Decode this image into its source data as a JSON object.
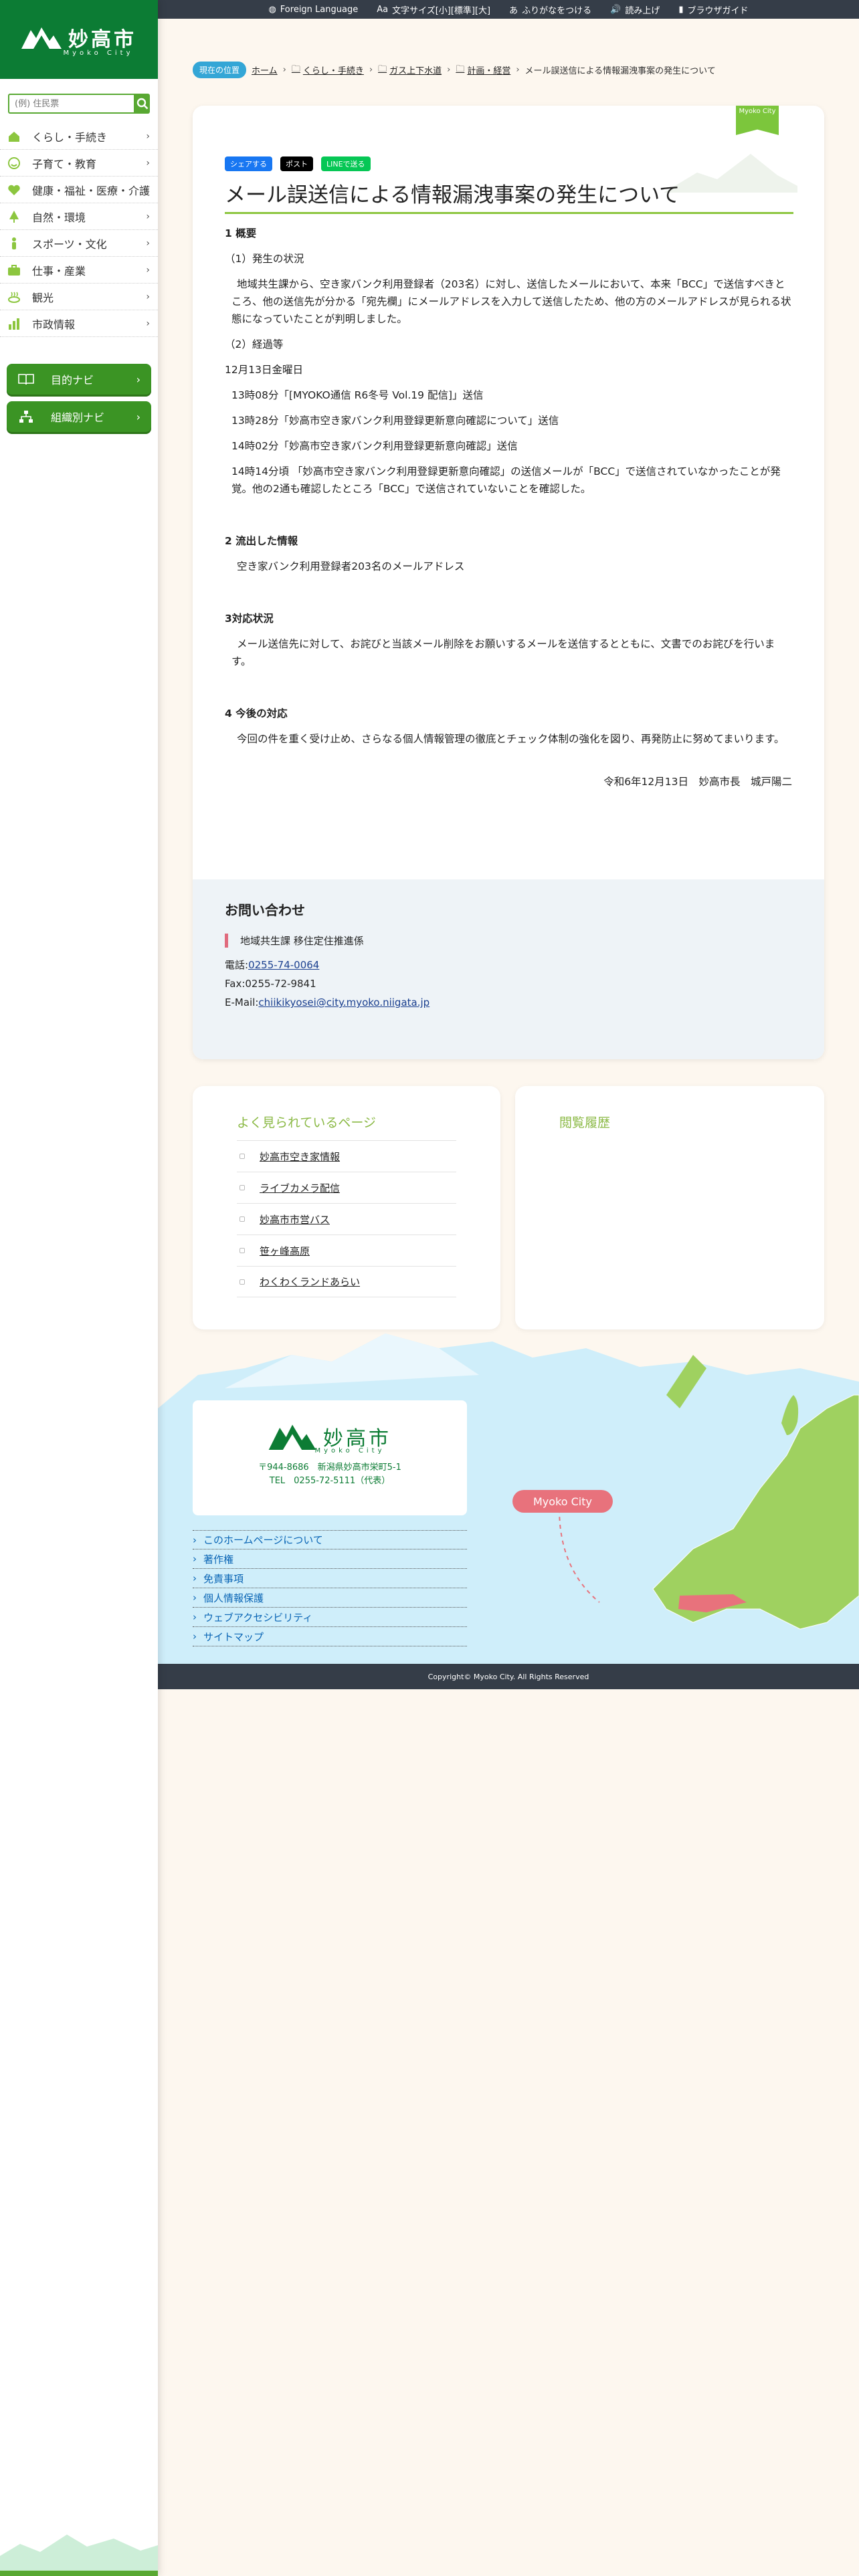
{
  "site": {
    "name": "妙高市",
    "sub": "Myoko City"
  },
  "topbar": {
    "foreign": "Foreign Language",
    "fontsize": "文字サイズ[小][標準][大]",
    "furigana": "ふりがなをつける",
    "readaloud": "読み上げ",
    "browser_guide": "ブラウザガイド"
  },
  "search": {
    "placeholder": "(例) 住民票"
  },
  "menu": [
    {
      "label": "くらし・手続き",
      "icon": "house-icon"
    },
    {
      "label": "子育て・教育",
      "icon": "smile-icon"
    },
    {
      "label": "健康・福祉・医療・介護",
      "icon": "heart-icon"
    },
    {
      "label": "自然・環境",
      "icon": "tree-icon"
    },
    {
      "label": "スポーツ・文化",
      "icon": "person-icon"
    },
    {
      "label": "仕事・産業",
      "icon": "briefcase-icon"
    },
    {
      "label": "観光",
      "icon": "onsen-icon"
    },
    {
      "label": "市政情報",
      "icon": "bar-chart-icon"
    }
  ],
  "navbuttons": {
    "purpose": "目的ナビ",
    "org": "組織別ナビ"
  },
  "breadcrumb": {
    "here": "現在の位置",
    "home": "ホーム",
    "c1": "くらし・手続き",
    "c2": "ガス上下水道",
    "c3": "計画・経営",
    "current": "メール誤送信による情報漏洩事案の発生について"
  },
  "flag": "Myoko City",
  "share": {
    "facebook": "シェアする",
    "x": "ポスト",
    "line": "LINEで送る"
  },
  "title": "メール誤送信による情報漏洩事案の発生について",
  "article": {
    "s1": "1 概要",
    "s1a": "（1）発生の状況",
    "s1a_text": "地域共生課から、空き家バンク利用登録者（203名）に対し、送信したメールにおいて、本来「BCC」で送信すべきところ、他の送信先が分かる「宛先欄」にメールアドレスを入力して送信したため、他の方のメールアドレスが見られる状態になっていたことが判明しました。",
    "s1b": "（2）経過等",
    "date": "12月13日金曜日",
    "t1": "13時08分「[MYOKO通信 R6冬号 Vol.19 配信]」送信",
    "t2": "13時28分「妙高市空き家バンク利用登録更新意向確認について」送信",
    "t3": "14時02分「妙高市空き家バンク利用登録更新意向確認」送信",
    "t4": "14時14分頃 「妙高市空き家バンク利用登録更新意向確認」の送信メールが「BCC」で送信されていなかったことが発覚。他の2通も確認したところ「BCC」で送信されていないことを確認した。",
    "s2": "2 流出した情報",
    "s2_text": "空き家バンク利用登録者203名のメールアドレス",
    "s3": "3対応状況",
    "s3_text": "メール送信先に対して、お詫びと当該メール削除をお願いするメールを送信するとともに、文書でのお詫びを行います。",
    "s4": "4 今後の対応",
    "s4_text": "今回の件を重く受け止め、さらなる個人情報管理の徹底とチェック体制の強化を図り、再発防止に努めてまいります。",
    "sign": "令和6年12月13日　妙高市長　城戸陽二"
  },
  "contact": {
    "title": "お問い合わせ",
    "dept": "地域共生課 移住定住推進係",
    "tel_label": "電話:",
    "tel": "0255-74-0064",
    "fax": "Fax:0255-72-9841",
    "email_label": "E-Mail:",
    "email": "chiikikyosei@city.myoko.niigata.jp"
  },
  "popular": {
    "title": "よく見られているページ",
    "items": [
      "妙高市空き家情報",
      "ライブカメラ配信",
      "妙高市市営バス",
      "笹ヶ峰高原",
      "わくわくランドあらい"
    ]
  },
  "history": {
    "title": "閲覧履歴"
  },
  "footer": {
    "name": "妙高市",
    "sub": "Myoko City",
    "address": "〒944-8686　新潟県妙高市栄町5-1",
    "tel": "TEL　0255-72-5111（代表）",
    "links": [
      "このホームページについて",
      "著作権",
      "免責事項",
      "個人情報保護",
      "ウェブアクセシビリティ",
      "サイトマップ"
    ],
    "copyright": "Copyright© Myoko City. All Rights Reserved",
    "map_tag": "Myoko City"
  },
  "colors": {
    "brand_green": "#0c7c34",
    "accent_green": "#58a832",
    "link_blue": "#0a65b5",
    "contact_accent": "#e06a7d"
  }
}
